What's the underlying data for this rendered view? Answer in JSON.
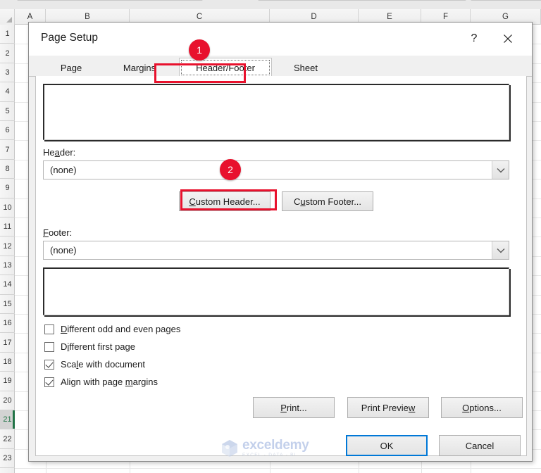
{
  "spreadsheet": {
    "columns": [
      "A",
      "B",
      "C",
      "D",
      "E",
      "F",
      "G"
    ],
    "rows": [
      "1",
      "2",
      "3",
      "4",
      "5",
      "6",
      "7",
      "8",
      "9",
      "10",
      "11",
      "12",
      "13",
      "14",
      "15",
      "16",
      "17",
      "18",
      "19",
      "20",
      "21",
      "22",
      "23"
    ],
    "selected_row": "21",
    "selection_color": "#217346"
  },
  "dialog": {
    "title": "Page Setup",
    "help_label": "?",
    "close_label": "✕",
    "tabs": [
      {
        "label": "Page",
        "active": false
      },
      {
        "label": "Margins",
        "active": false
      },
      {
        "label": "Header/Footer",
        "active": true
      },
      {
        "label": "Sheet",
        "active": false
      }
    ],
    "header": {
      "label_prefix": "He",
      "label_accel": "a",
      "label_suffix": "der:",
      "value": "(none)",
      "dropdown_icon": "chevron-down-icon"
    },
    "footer": {
      "label_prefix": "",
      "label_accel": "F",
      "label_suffix": "ooter:",
      "value": "(none)",
      "dropdown_icon": "chevron-down-icon"
    },
    "custom_header": {
      "prefix": "",
      "accel": "C",
      "suffix": "ustom Header..."
    },
    "custom_footer": {
      "prefix": "C",
      "accel": "u",
      "suffix": "stom Footer..."
    },
    "checkboxes": [
      {
        "prefix": "",
        "accel": "D",
        "suffix": "ifferent odd and even pages",
        "checked": false
      },
      {
        "prefix": "D",
        "accel": "i",
        "suffix": "fferent first page",
        "checked": false
      },
      {
        "prefix": "Sca",
        "accel": "l",
        "suffix": "e with document",
        "checked": true
      },
      {
        "prefix": "Align with page ",
        "accel": "m",
        "suffix": "argins",
        "checked": true
      }
    ],
    "action_buttons": [
      {
        "prefix": "",
        "accel": "P",
        "suffix": "rint..."
      },
      {
        "prefix": "Print Previe",
        "accel": "w",
        "suffix": ""
      },
      {
        "prefix": "",
        "accel": "O",
        "suffix": "ptions..."
      }
    ],
    "ok_label": "OK",
    "cancel_label": "Cancel"
  },
  "annotations": {
    "badges": [
      {
        "number": "1",
        "target": "tab-header-footer"
      },
      {
        "number": "2",
        "target": "custom-header-button"
      }
    ],
    "highlight_color": "#e8112d"
  },
  "watermark": {
    "name": "exceldemy",
    "tagline": "EXCEL - DATA - BI"
  }
}
